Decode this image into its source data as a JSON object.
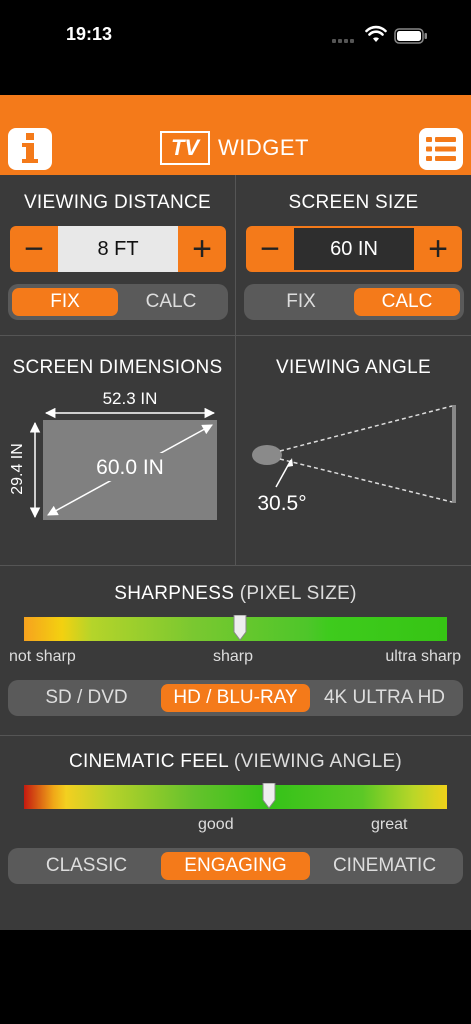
{
  "status": {
    "time": "19:13"
  },
  "header": {
    "logo_tv": "TV",
    "logo_word": "WIDGET"
  },
  "viewing_distance": {
    "title": "VIEWING DISTANCE",
    "minus": "−",
    "value": "8 FT",
    "plus": "+",
    "modes": [
      "FIX",
      "CALC"
    ],
    "active_mode": "FIX"
  },
  "screen_size": {
    "title": "SCREEN SIZE",
    "minus": "−",
    "value": "60 IN",
    "plus": "+",
    "modes": [
      "FIX",
      "CALC"
    ],
    "active_mode": "CALC"
  },
  "screen_dimensions": {
    "title": "SCREEN DIMENSIONS",
    "width": "52.3 IN",
    "height": "29.4 IN",
    "diagonal": "60.0 IN"
  },
  "viewing_angle": {
    "title": "VIEWING ANGLE",
    "angle": "30.5°"
  },
  "sharpness": {
    "title": "SHARPNESS",
    "subtitle": "(PIXEL SIZE)",
    "labels": [
      "not sharp",
      "sharp",
      "ultra sharp"
    ],
    "marker_fraction": 0.51,
    "options": [
      "SD / DVD",
      "HD / BLU-RAY",
      "4K ULTRA HD"
    ],
    "active_option": "HD / BLU-RAY"
  },
  "cinematic": {
    "title": "CINEMATIC FEEL",
    "subtitle": "(VIEWING ANGLE)",
    "labels": [
      "good",
      "great"
    ],
    "marker_fraction": 0.58,
    "options": [
      "CLASSIC",
      "ENGAGING",
      "CINEMATIC"
    ],
    "active_option": "ENGAGING"
  },
  "colors": {
    "accent": "#f47a1a",
    "panel": "#3a3a3a"
  }
}
